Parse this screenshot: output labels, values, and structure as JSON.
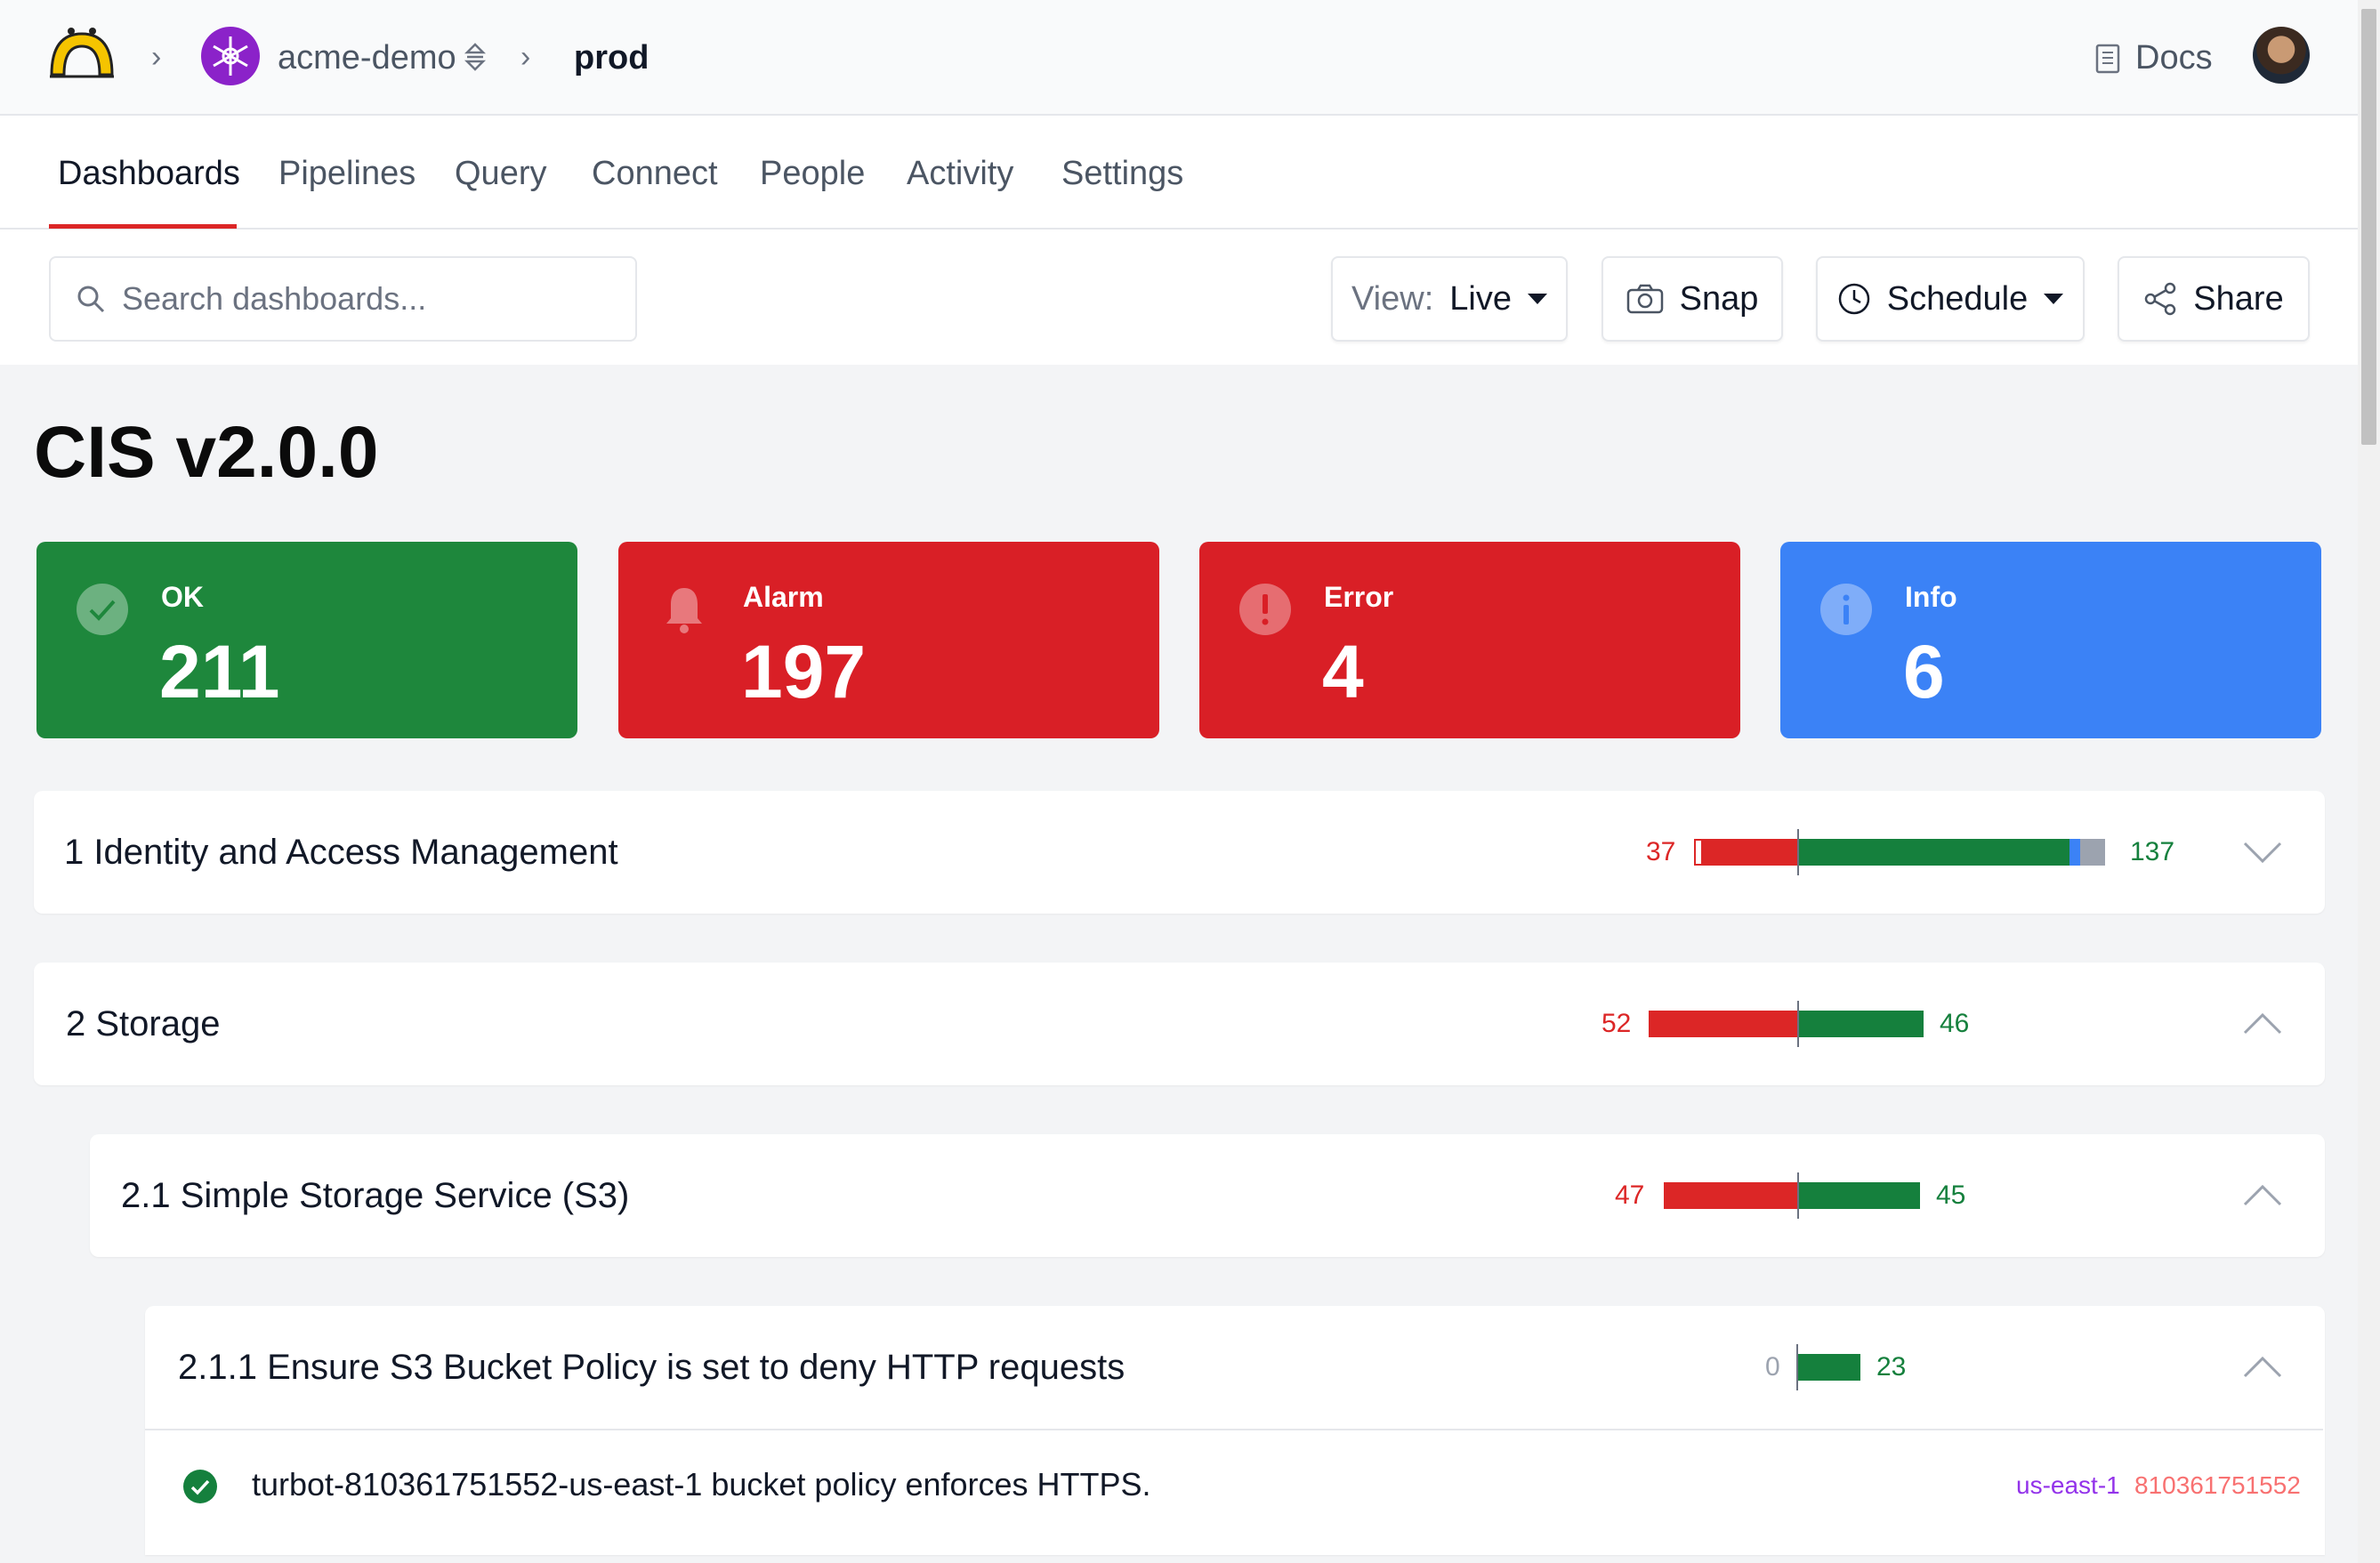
{
  "header": {
    "org_name": "acme-demo",
    "workspace_name": "prod",
    "docs_label": "Docs"
  },
  "tabs": [
    {
      "label": "Dashboards",
      "active": true
    },
    {
      "label": "Pipelines"
    },
    {
      "label": "Query"
    },
    {
      "label": "Connect"
    },
    {
      "label": "People"
    },
    {
      "label": "Activity"
    },
    {
      "label": "Settings"
    }
  ],
  "toolbar": {
    "search_placeholder": "Search dashboards...",
    "view_prefix": "View:",
    "view_value": "Live",
    "snap_label": "Snap",
    "schedule_label": "Schedule",
    "share_label": "Share"
  },
  "page": {
    "title": "CIS v2.0.0"
  },
  "summary": {
    "ok": {
      "label": "OK",
      "value": "211",
      "color": "#1e873c"
    },
    "alarm": {
      "label": "Alarm",
      "value": "197",
      "color": "#d91f26"
    },
    "error": {
      "label": "Error",
      "value": "4",
      "color": "#d91f26"
    },
    "info": {
      "label": "Info",
      "value": "6",
      "color": "#3b82f6"
    }
  },
  "sections": [
    {
      "title": "1 Identity and Access Management",
      "alarm": "37",
      "ok": "137",
      "expanded": false
    },
    {
      "title": "2 Storage",
      "alarm": "52",
      "ok": "46",
      "expanded": true
    },
    {
      "title": "2.1 Simple Storage Service (S3)",
      "alarm": "47",
      "ok": "45",
      "expanded": true
    },
    {
      "title": "2.1.1 Ensure S3 Bucket Policy is set to deny HTTP requests",
      "alarm": "0",
      "ok": "23",
      "expanded": true
    }
  ],
  "results": [
    {
      "status": "ok",
      "text": "turbot-810361751552-us-east-1 bucket policy enforces HTTPS.",
      "region": "us-east-1",
      "account": "810361751552"
    }
  ],
  "colors": {
    "alarm": "#dc2626",
    "ok": "#15803d",
    "info": "#3b82f6",
    "skip": "#9ca3af",
    "accent": "#dc2626"
  }
}
